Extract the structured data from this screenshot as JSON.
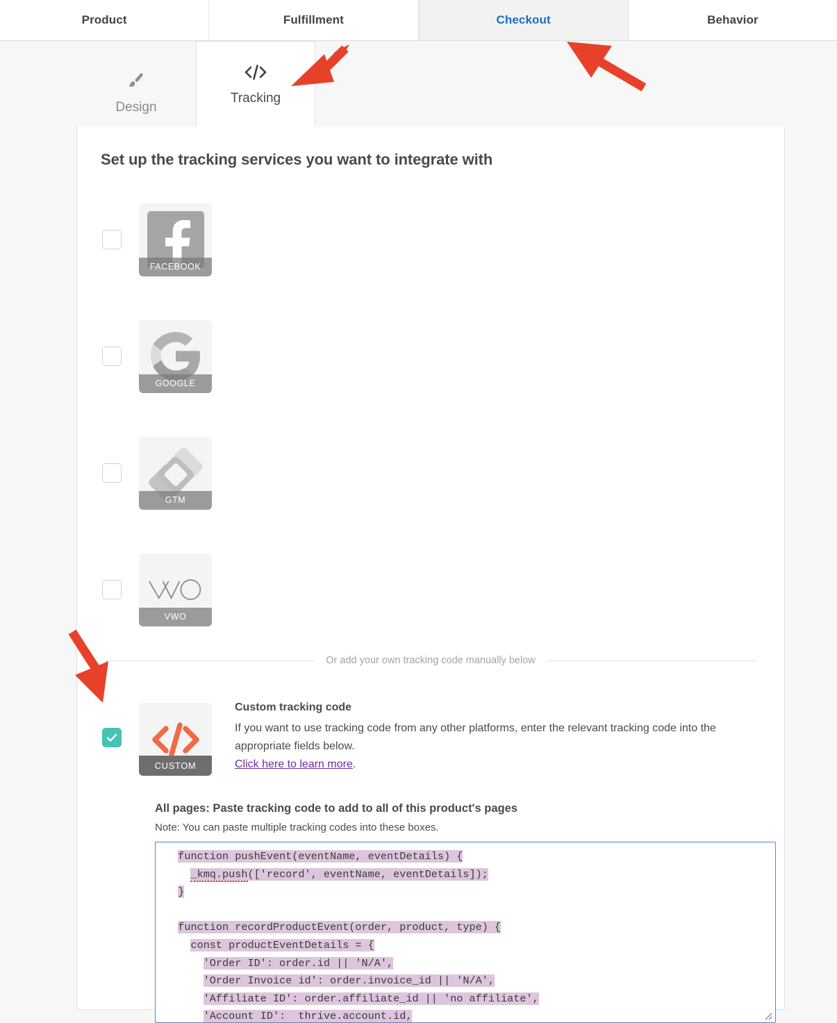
{
  "top_tabs": [
    {
      "label": "Product",
      "active": false
    },
    {
      "label": "Fulfillment",
      "active": false
    },
    {
      "label": "Checkout",
      "active": true
    },
    {
      "label": "Behavior",
      "active": false
    }
  ],
  "sub_tabs": [
    {
      "label": "Design",
      "icon": "paintbrush-icon",
      "active": false
    },
    {
      "label": "Tracking",
      "icon": "code-brackets-icon",
      "active": true
    }
  ],
  "card": {
    "heading": "Set up the tracking services you want to integrate with",
    "divider_text": "Or add your own tracking code manually below"
  },
  "services": [
    {
      "name": "facebook",
      "label": "FACEBOOK",
      "checked": false
    },
    {
      "name": "google",
      "label": "GOOGLE",
      "checked": false
    },
    {
      "name": "gtm",
      "label": "GTM",
      "checked": false
    },
    {
      "name": "vwo",
      "label": "VWO",
      "checked": false
    }
  ],
  "custom": {
    "label": "CUSTOM",
    "checked": true,
    "title": "Custom tracking code",
    "description": "If you want to use tracking code from any other platforms, enter the relevant tracking code into the appropriate fields below.",
    "link_text": "Click here to learn more",
    "link_suffix": "."
  },
  "code_section": {
    "label": "All pages: Paste tracking code to add to all of this product's pages",
    "note": "Note: You can paste multiple tracking codes into these boxes.",
    "lines": [
      "  function pushEvent(eventName, eventDetails) {",
      "    _kmq.push(['record', eventName, eventDetails]);",
      "  }",
      "",
      "  function recordProductEvent(order, product, type) {",
      "    const productEventDetails = {",
      "      'Order ID': order.id || 'N/A',",
      "      'Order Invoice id': order.invoice_id || 'N/A',",
      "      'Affiliate ID': order.affiliate_id || 'no affiliate',",
      "      'Account ID':  thrive.account.id,"
    ]
  },
  "colors": {
    "accent_blue": "#1a6fc4",
    "checkbox_teal": "#46c3b2",
    "arrow_red": "#e8412a",
    "custom_orange": "#ef6a45",
    "link_purple": "#6b2d9e",
    "selection_purple": "#ddc6dd",
    "textarea_border": "#4a86e8"
  }
}
